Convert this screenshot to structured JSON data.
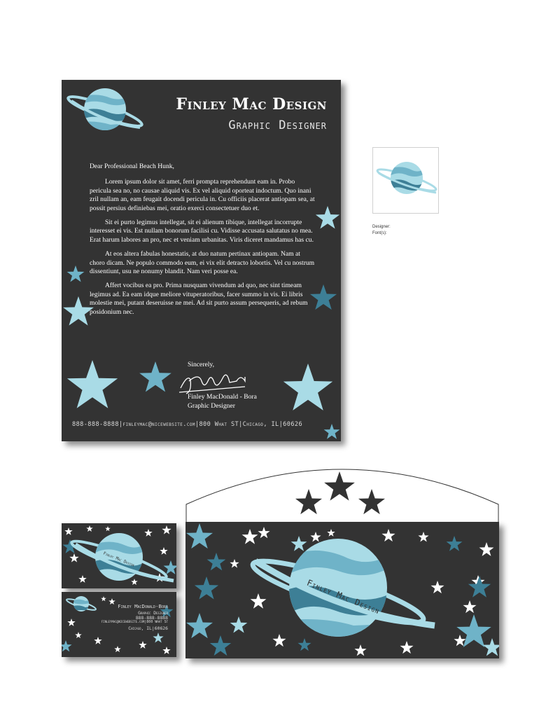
{
  "letterhead": {
    "company": "Finley Mac Design",
    "role": "Graphic Designer",
    "salutation": "Dear Professional Beach Hunk,",
    "paragraphs": [
      "Lorem ipsum dolor sit amet, ferri prompta reprehendunt eam in. Probo pericula sea no, no causae aliquid vis. Ex vel aliquid oporteat indoctum. Quo inani zril nullam an, eam feugait docendi pericula in. Cu officiis placerat antiopam sea, at possit persius definiebas mei, oratio exerci consectetuer duo et.",
      "Sit ei purto legimus intellegat, sit ei alienum tibique, intellegat incorrupte interesset ei vis. Est nullam bonorum facilisi cu. Vidisse accusata salutatus no mea. Erat harum labores an pro, nec et veniam urbanitas. Viris diceret mandamus has cu.",
      "At eos altera fabulas honestatis, at duo natum pertinax antiopam. Nam at choro dicam. Ne populo commodo eum, ei vix elit detracto lobortis. Vel cu nostrum dissentiunt, usu ne nonumy blandit. Nam veri posse ea.",
      "Affert vocibus ea pro. Prima nusquam vivendum ad quo, nec sint timeam legimus ad. Ea eam idque meliore vituperatoribus, facer summo in vis. Ei libris molestie mei, putant deseruisse ne mei. Ad sit purto assum persequeris, ad rebum posidonium nec."
    ],
    "closing": "Sincerely,",
    "signature_name": "Finley MacDonald - Bora",
    "signature_title": "Graphic Designer",
    "footer": "888-888-8888|finleymac@nicewebsite.com|800 What ST|Chicago, IL|60626"
  },
  "logo_notes": {
    "designer_label": "Designer:",
    "fonts_label": "Font(s):"
  },
  "business_card": {
    "front_ring_text": "Finley Mac Design",
    "back_lines": [
      "Finley MacDonald-Bora",
      "Graphic Designer",
      "888-888-8888",
      "finleymac@nicewebsite.com|800 What St",
      "Chicago, IL|60626"
    ]
  },
  "envelope": {
    "ring_text": "Finley Mac Design"
  },
  "colors": {
    "background": "#333333",
    "planet_light": "#a9dbe6",
    "planet_mid": "#6fb3c8",
    "planet_dark": "#3d7f96",
    "star": "#a9dbe6",
    "star_dark": "#3d7f96",
    "white_star": "#ffffff"
  }
}
